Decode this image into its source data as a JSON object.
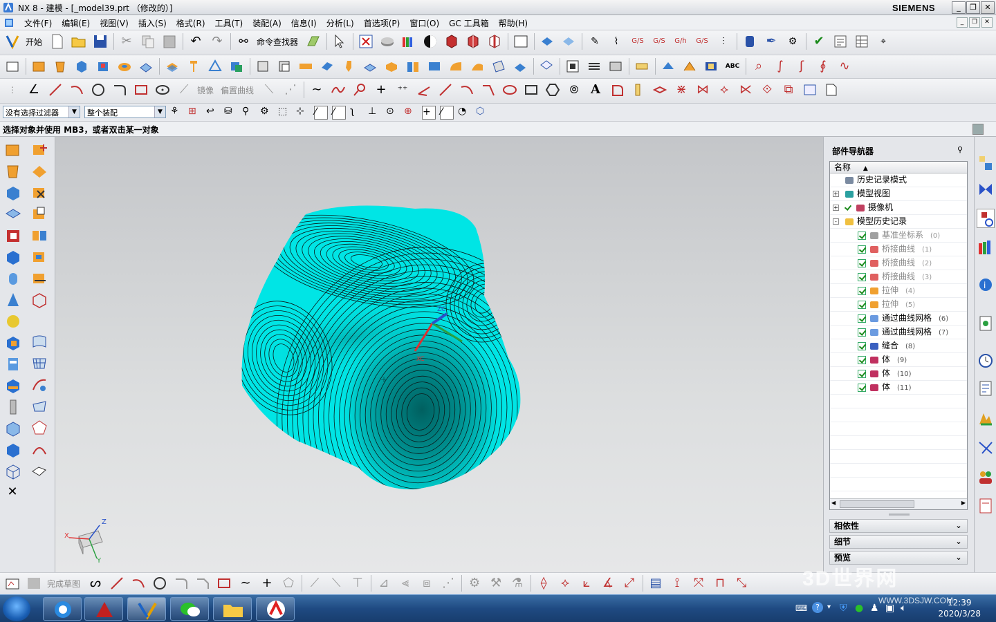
{
  "window": {
    "title": "NX 8 - 建模 - [_model39.prt （修改的）]",
    "brand": "SIEMENS",
    "controls": [
      "minimize",
      "maximize",
      "close"
    ]
  },
  "menubar": {
    "items": [
      "文件(F)",
      "编辑(E)",
      "视图(V)",
      "插入(S)",
      "格式(R)",
      "工具(T)",
      "装配(A)",
      "信息(I)",
      "分析(L)",
      "首选项(P)",
      "窗口(O)",
      "GC 工具箱",
      "帮助(H)"
    ]
  },
  "toolbar_standard": {
    "start_label": "开始",
    "command_finder_label": "命令查找器"
  },
  "toolbar_curve": {
    "mirror_label": "镜像",
    "offset_curve_label": "偏置曲线"
  },
  "selection": {
    "filter_value": "没有选择过滤器",
    "scope_value": "整个装配"
  },
  "status": {
    "prompt": "选择对象并使用 MB3，或者双击某一对象"
  },
  "navigator": {
    "title": "部件导航器",
    "column_name": "名称",
    "nodes": [
      {
        "label": "历史记录模式",
        "icon": "clock-icon",
        "level": 0,
        "expander": "",
        "checked": false,
        "grey": false,
        "num": ""
      },
      {
        "label": "模型视图",
        "icon": "model-view-icon",
        "level": 0,
        "expander": "+",
        "checked": false,
        "grey": false,
        "num": ""
      },
      {
        "label": "摄像机",
        "icon": "camera-icon",
        "level": 0,
        "expander": "+",
        "checked": true,
        "grey": false,
        "num": ""
      },
      {
        "label": "模型历史记录",
        "icon": "folder-icon",
        "level": 0,
        "expander": "-",
        "checked": false,
        "grey": false,
        "num": ""
      },
      {
        "label": "基准坐标系",
        "icon": "datum-csys-icon",
        "level": 1,
        "expander": "",
        "checked": true,
        "grey": true,
        "num": "(0)"
      },
      {
        "label": "桥接曲线",
        "icon": "bridge-curve-icon",
        "level": 1,
        "expander": "",
        "checked": true,
        "grey": true,
        "num": "(1)"
      },
      {
        "label": "桥接曲线",
        "icon": "bridge-curve-icon",
        "level": 1,
        "expander": "",
        "checked": true,
        "grey": true,
        "num": "(2)"
      },
      {
        "label": "桥接曲线",
        "icon": "bridge-curve-icon",
        "level": 1,
        "expander": "",
        "checked": true,
        "grey": true,
        "num": "(3)"
      },
      {
        "label": "拉伸",
        "icon": "extrude-icon",
        "level": 1,
        "expander": "",
        "checked": true,
        "grey": true,
        "num": "(4)"
      },
      {
        "label": "拉伸",
        "icon": "extrude-icon",
        "level": 1,
        "expander": "",
        "checked": true,
        "grey": true,
        "num": "(5)"
      },
      {
        "label": "通过曲线网格",
        "icon": "curve-mesh-icon",
        "level": 1,
        "expander": "",
        "checked": true,
        "grey": false,
        "num": "(6)"
      },
      {
        "label": "通过曲线网格",
        "icon": "curve-mesh-icon",
        "level": 1,
        "expander": "",
        "checked": true,
        "grey": false,
        "num": "(7)"
      },
      {
        "label": "缝合",
        "icon": "sew-icon",
        "level": 1,
        "expander": "",
        "checked": true,
        "grey": false,
        "num": "(8)"
      },
      {
        "label": "体",
        "icon": "body-icon",
        "level": 1,
        "expander": "",
        "checked": true,
        "grey": false,
        "num": "(9)"
      },
      {
        "label": "体",
        "icon": "body-icon",
        "level": 1,
        "expander": "",
        "checked": true,
        "grey": false,
        "num": "(10)"
      },
      {
        "label": "体",
        "icon": "body-icon",
        "level": 1,
        "expander": "",
        "checked": true,
        "grey": false,
        "num": "(11)"
      }
    ],
    "panels": [
      "相依性",
      "细节",
      "预览"
    ]
  },
  "sketch_toolbar": {
    "finish_sketch_label": "完成草图"
  },
  "triad": {
    "x": "X",
    "y": "Y",
    "z": "Z"
  },
  "taskbar": {
    "time": "12:39",
    "date": "2020/3/28"
  },
  "watermark": {
    "text": "3D世界网",
    "url": "WWW.3DSJW.COM"
  },
  "colors": {
    "surface": "#00e5e5",
    "surface_shadow": "#007a7a",
    "contour": "#0b1a1a",
    "viewport_top": "#c4c6c9",
    "viewport_bottom": "#e6e7e8"
  }
}
